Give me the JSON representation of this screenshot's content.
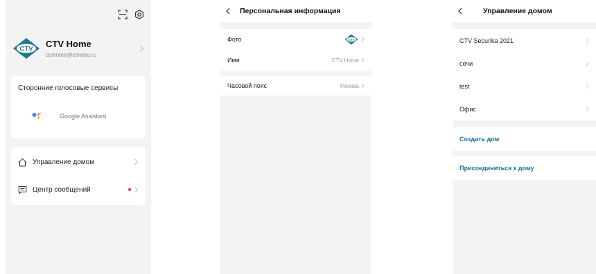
{
  "profile_screen": {
    "user_name": "CTV Home",
    "user_email": "ctvhome@ctvideo.ru",
    "logo_text": "CTV",
    "voice_services_title": "Сторонние голосовые сервисы",
    "google_assistant_label": "Google Assistant",
    "menu": {
      "home_management": "Управление домом",
      "message_center": "Центр сообщений"
    },
    "icons": [
      "scan-icon",
      "settings-icon",
      "home-icon",
      "message-icon",
      "chevron-right-icon"
    ],
    "colors": {
      "logo": "#1f7a8c",
      "notification_dot": "#e0354b"
    }
  },
  "personal_screen": {
    "title": "Персональная информация",
    "rows": [
      {
        "label": "Фото",
        "value": ""
      },
      {
        "label": "Имя",
        "value": "CTV Home"
      },
      {
        "label": "Часовой пояс",
        "value": "Москва"
      }
    ]
  },
  "home_screen": {
    "title": "Управление домом",
    "homes": [
      "CTV Securika 2021",
      "сочи",
      "test",
      "Офис"
    ],
    "create_home": "Создать дом",
    "join_home": "Присоединиться к дому",
    "colors": {
      "action": "#1a6fa0"
    }
  }
}
